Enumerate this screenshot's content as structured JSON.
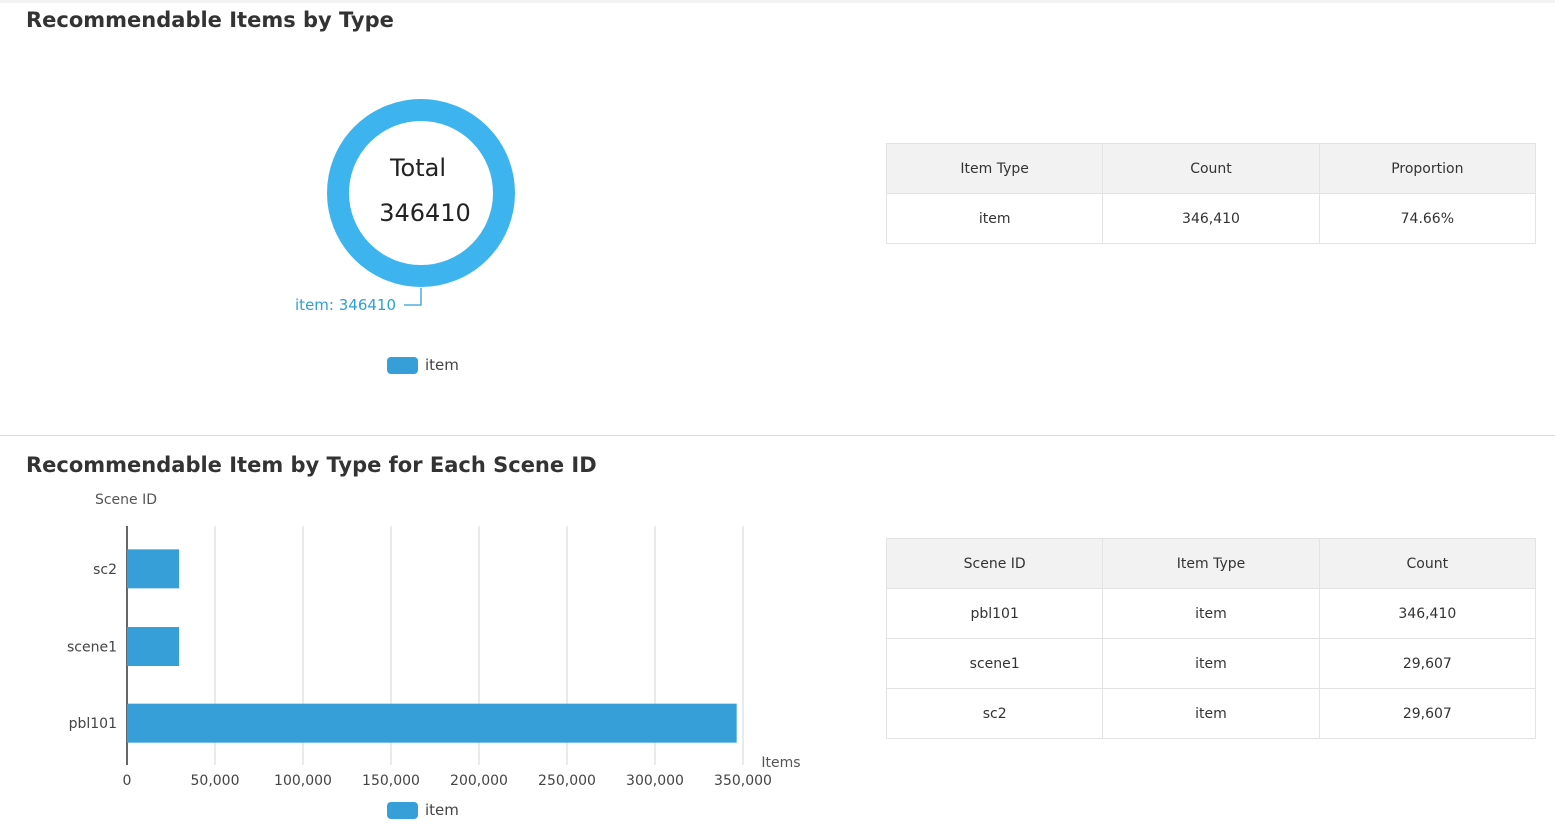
{
  "colors": {
    "donut": "#3db4ee",
    "bar": "#379fd8",
    "label": "#2f9fd8",
    "grid": "#d6d6d6"
  },
  "section1": {
    "title": "Recommendable Items by Type",
    "donut_center": {
      "label": "Total",
      "value": "346410"
    },
    "legend_label": "item",
    "table": {
      "headers": [
        "Item Type",
        "Count",
        "Proportion"
      ],
      "rows": [
        [
          "item",
          "346,410",
          "74.66%"
        ]
      ]
    }
  },
  "section2": {
    "title": "Recommendable Item by Type for Each Scene ID",
    "legend_label": "item",
    "table": {
      "headers": [
        "Scene ID",
        "Item Type",
        "Count"
      ],
      "rows": [
        [
          "pbl101",
          "item",
          "346,410"
        ],
        [
          "scene1",
          "item",
          "29,607"
        ],
        [
          "sc2",
          "item",
          "29,607"
        ]
      ]
    }
  },
  "chart_data": [
    {
      "type": "pie",
      "donut": true,
      "series": [
        {
          "name": "item",
          "values": [
            346410
          ]
        }
      ],
      "categories": [
        "item"
      ],
      "slice_labels": [
        "item: 346410"
      ],
      "legend": [
        "item"
      ]
    },
    {
      "type": "bar",
      "orientation": "horizontal",
      "categories": [
        "pbl101",
        "scene1",
        "sc2"
      ],
      "series": [
        {
          "name": "item",
          "values": [
            346410,
            29607,
            29607
          ]
        }
      ],
      "ylabel": "Scene ID",
      "xlabel": "Items",
      "xlim": [
        0,
        350000
      ],
      "xticks": [
        "0",
        "50,000",
        "100,000",
        "150,000",
        "200,000",
        "250,000",
        "300,000",
        "350,000"
      ],
      "grid": true,
      "legend": [
        "item"
      ]
    }
  ]
}
